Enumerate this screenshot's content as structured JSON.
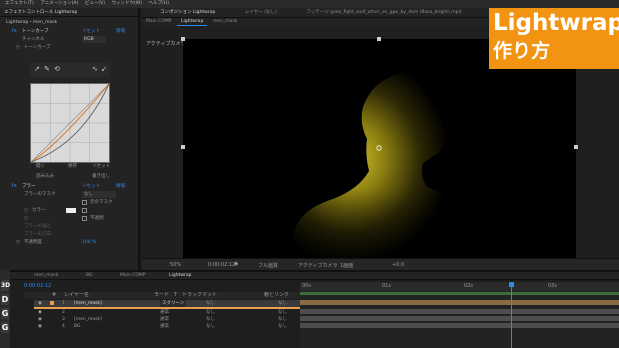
{
  "menu": [
    "エフェクト(T)",
    "アニメーション(A)",
    "ビュー(V)",
    "ウィンドウ(W)",
    "ヘルプ(H)"
  ],
  "effects_panel": {
    "tab": "エフェクトコントロール Lightwrap",
    "breadcrumb": "Lightwrap・men_mask",
    "rows": [
      {
        "label": "トーンカーブ",
        "value": "リセット",
        "extra": "情報"
      },
      {
        "label": "チャンネル",
        "value": "RGB"
      },
      {
        "label": "トーンカーブ",
        "value": ""
      }
    ],
    "graph_buttons": [
      "リセット",
      "開く",
      "保存"
    ],
    "graph_footer": [
      "読み込み",
      "書き出し"
    ],
    "blur_section": {
      "label": "ブラー",
      "value": "リセット",
      "extra": "情報"
    },
    "blur_rows": [
      "ブラーのマスク",
      "マスクの設定",
      "カラー",
      "不透明",
      "ブラーの強さ",
      "ブラーの方向",
      "不透明度"
    ],
    "blur_values": [
      "なし",
      "元のマスク",
      "",
      "",
      "",
      "",
      "100 %"
    ]
  },
  "viewer": {
    "tabs": [
      "コンポジション Lightwrap",
      "レイヤー (なし)",
      "フッテージ gaea_fight_wolf_other_on_gpe_by_dom (Basa_bright).mp4"
    ],
    "subtabs": [
      "Main COMP",
      "Lightwrap",
      "men_mask"
    ],
    "label": "アクティブカメラ",
    "bottom": [
      "50%",
      "0:00:02:12",
      "フル画質",
      "アクティブカメラ",
      "1画面",
      "+0.0"
    ]
  },
  "title": {
    "line1": "Lightwrap",
    "line2": "作り方"
  },
  "timeline": {
    "tabs": [
      "men_mask",
      "BG",
      "Main COMP",
      "Lightwrap"
    ],
    "timecode": "0:00:02:12",
    "columns": [
      "#",
      "レイヤー名",
      "モード",
      "T",
      "トラックマット",
      "親とリンク"
    ],
    "layers": [
      {
        "num": "1",
        "name": "[men_mask]",
        "mode": "スクリーン",
        "matte": "なし",
        "parent": "なし"
      },
      {
        "num": "2",
        "name": "",
        "mode": "通常",
        "matte": "なし",
        "parent": "なし"
      },
      {
        "num": "3",
        "name": "[men_mask]",
        "mode": "通常",
        "matte": "なし",
        "parent": "なし"
      },
      {
        "num": "4",
        "name": "BG",
        "mode": "通常",
        "matte": "なし",
        "parent": "なし"
      }
    ],
    "ruler": [
      "00s",
      "01s",
      "02s",
      "03s",
      "04s"
    ],
    "playhead": 0.66
  },
  "dock": [
    "3D",
    "D",
    "G",
    "G"
  ],
  "colors": {
    "accent": "#2d8ceb",
    "title_bg": "#f39312",
    "glow": "#d4c52a",
    "label_orange": "#e8a04c"
  }
}
